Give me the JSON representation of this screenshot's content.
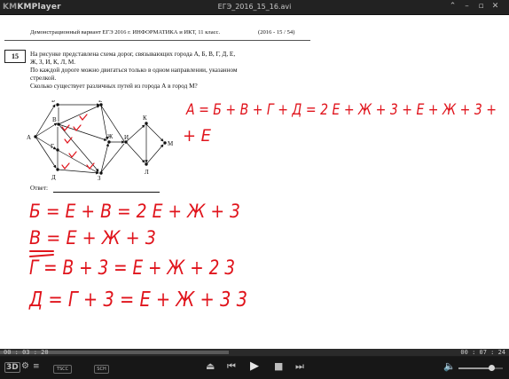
{
  "window": {
    "app_name": "KMPlayer",
    "title": "ЕГЭ_2016_15_16.avi",
    "controls": [
      "pin",
      "minimize",
      "maximize",
      "close"
    ]
  },
  "document": {
    "header": "Демонстрационный вариант ЕГЭ 2016 г. ИНФОРМАТИКА и ИКТ, 11 класс.",
    "page_info": "(2016 - 15 / 54)",
    "task_number": "15",
    "task_lines": [
      "На рисунке представлена схема дорог, связывающих города А, Б, В, Г, Д, Е,",
      "Ж, З, И, К, Л, М.",
      "По каждой дороге можно двигаться только в одном направлении, указанном",
      "стрелкой.",
      "Сколько существует различных путей из города А в город М?"
    ],
    "answer_label": "Ответ:",
    "graph_nodes": [
      "А",
      "Б",
      "В",
      "Г",
      "Д",
      "Е",
      "Ж",
      "З",
      "И",
      "К",
      "Л",
      "М"
    ]
  },
  "handwriting": {
    "ink_color": "#e0141c",
    "top_right": [
      "А = Б + В + Г + Д = 2 Е + Ж + 3 + Е + Ж + 3 +",
      "+ Е"
    ],
    "lines": [
      "Б = Е + В = 2 Е + Ж + 3",
      "В = Е + Ж + 3",
      "Г = В + 3 = Е + Ж + 2 3",
      "Д = Г + 3 = Е + Ж + 3 3"
    ]
  },
  "player": {
    "time_current": "00 : 03 : 20",
    "time_total": "00 : 07 : 24",
    "progress": 0.45,
    "volume": 0.74,
    "badges": [
      "3D",
      "TSCC",
      "SCH"
    ]
  }
}
